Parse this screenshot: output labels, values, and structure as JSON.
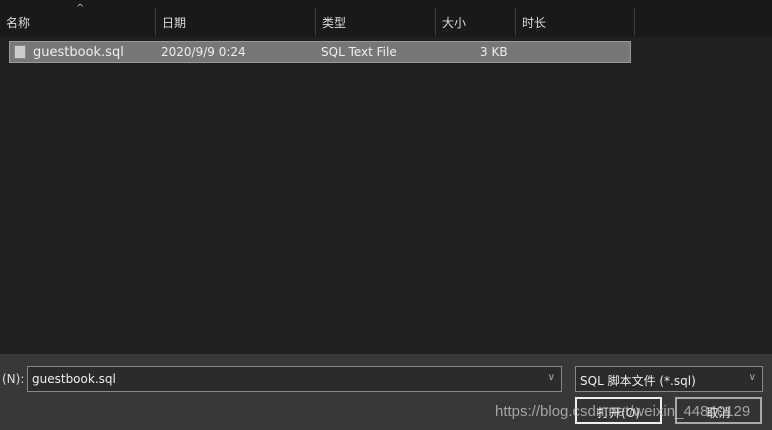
{
  "columns": [
    "名称",
    "日期",
    "类型",
    "大小",
    "时长"
  ],
  "files": [
    {
      "name": "guestbook.sql",
      "date": "2020/9/9 0:24",
      "type": "SQL Text File",
      "size": "3 KB"
    }
  ],
  "filename_label": "(N):",
  "filename_value": "guestbook.sql",
  "filter_value": "SQL 脚本文件 (*.sql)",
  "open_label": "打开(O)",
  "cancel_label": "取消",
  "watermark": "https://blog.csdn.net/weixin_44840129"
}
